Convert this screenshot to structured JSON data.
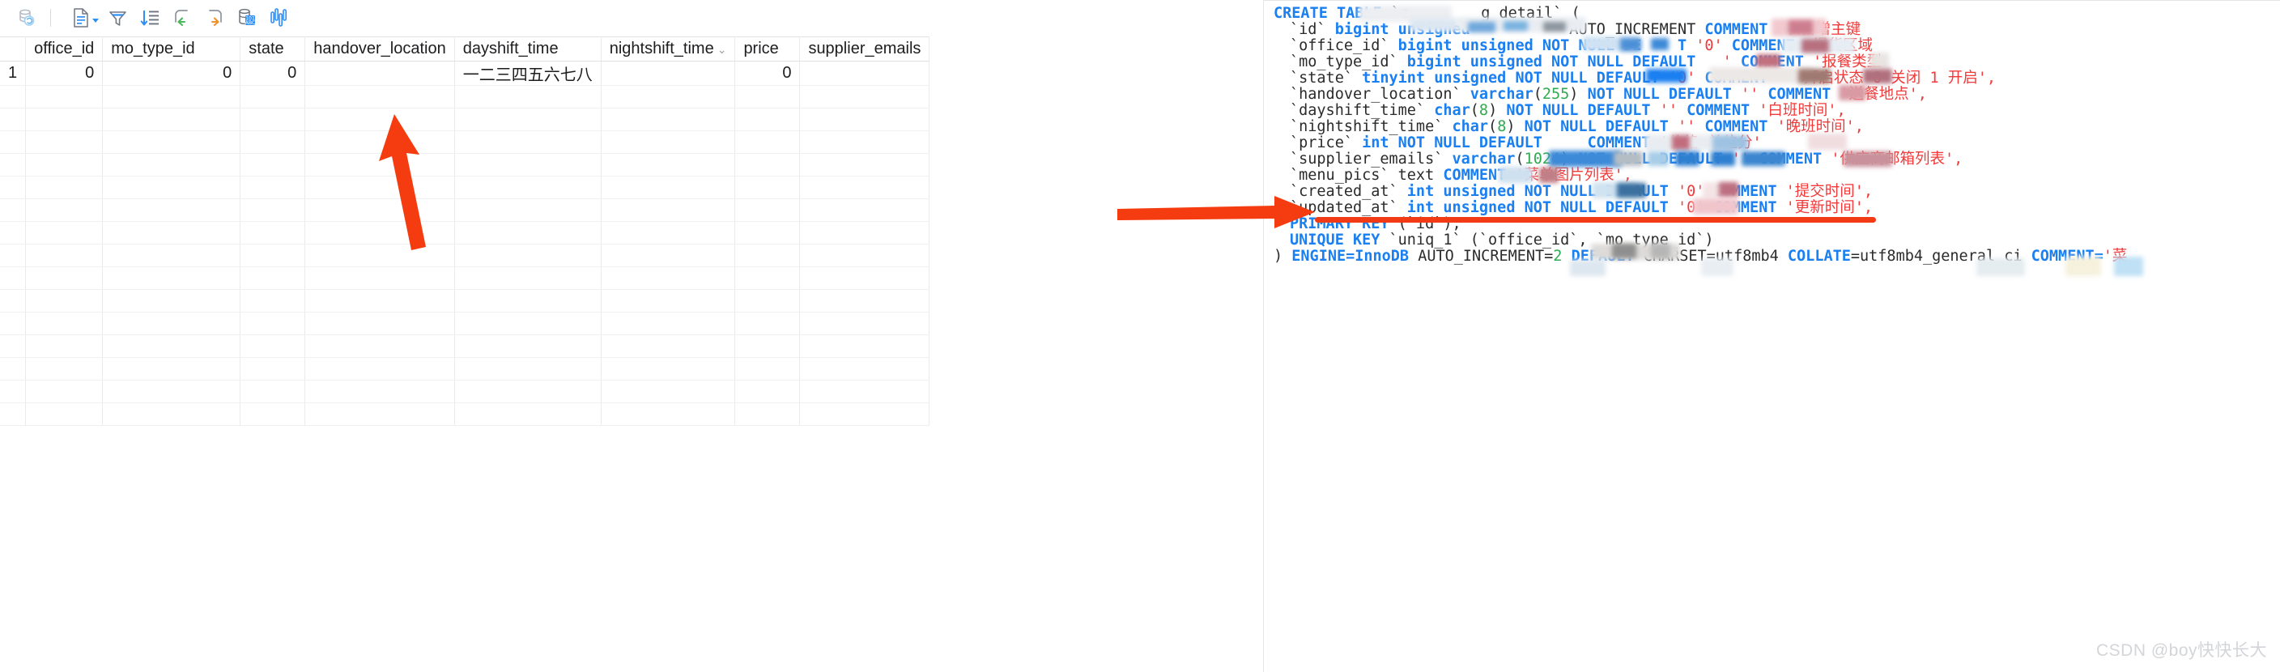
{
  "toolbar": {
    "buttons": [
      {
        "name": "refresh-database-icon",
        "title": "Refresh"
      },
      {
        "name": "separator",
        "title": ""
      },
      {
        "name": "document-dropdown-icon",
        "title": "Generate SQL"
      },
      {
        "name": "filter-icon",
        "title": "Filter"
      },
      {
        "name": "sort-icon",
        "title": "Sort"
      },
      {
        "name": "undo-icon",
        "title": "Undo"
      },
      {
        "name": "redo-icon",
        "title": "Redo"
      },
      {
        "name": "database-text-icon",
        "title": "View as text"
      },
      {
        "name": "chart-bars-icon",
        "title": "Chart"
      }
    ]
  },
  "grid": {
    "row_header": "",
    "columns": [
      {
        "label": "office_id",
        "caret": false,
        "align": "right",
        "width": 88
      },
      {
        "label": "mo_type_id",
        "caret": false,
        "align": "right",
        "width": 170
      },
      {
        "label": "state",
        "caret": false,
        "align": "right",
        "width": 80
      },
      {
        "label": "handover_location",
        "caret": false,
        "align": "left",
        "width": 140
      },
      {
        "label": "dayshift_time",
        "caret": false,
        "align": "left",
        "width": 170
      },
      {
        "label": "nightshift_time",
        "caret": true,
        "align": "left",
        "width": 115
      },
      {
        "label": "price",
        "caret": false,
        "align": "right",
        "width": 80
      },
      {
        "label": "supplier_emails",
        "caret": false,
        "align": "left",
        "width": 110
      }
    ],
    "rows": [
      {
        "num": "1",
        "cells": [
          "0",
          "0",
          "0",
          "",
          "一二三四五六七八",
          "",
          "0",
          ""
        ]
      }
    ],
    "empty_row_count": 15
  },
  "sql": {
    "lines": [
      {
        "indent": 0,
        "tokens": [
          {
            "t": "CREATE TABLE ",
            "c": "kw"
          },
          {
            "t": "`c",
            "c": "tick"
          },
          {
            "t": "        ",
            "c": "tick"
          },
          {
            "t": "g_detail` (",
            "c": "tick"
          }
        ]
      },
      {
        "indent": 1,
        "tokens": [
          {
            "t": "`id` ",
            "c": "tick"
          },
          {
            "t": "bigint unsigned",
            "c": "kw"
          },
          {
            "t": " ",
            "c": "plain"
          },
          {
            "t": "        ",
            "c": "plain"
          },
          {
            "t": "  AUTO_INCREMENT ",
            "c": "plain"
          },
          {
            "t": "COMMENT ",
            "c": "kw"
          },
          {
            "t": "'表自增主键",
            "c": "str"
          }
        ]
      },
      {
        "indent": 1,
        "tokens": [
          {
            "t": "`office_id` ",
            "c": "tick"
          },
          {
            "t": "bigint unsigned NOT NULL DE",
            "c": "kw"
          },
          {
            "t": "  ",
            "c": "kw"
          },
          {
            "t": "  T ",
            "c": "kw"
          },
          {
            "t": "'0' ",
            "c": "str"
          },
          {
            "t": "COMMENT ",
            "c": "kw"
          },
          {
            "t": "'提货区域",
            "c": "str"
          }
        ]
      },
      {
        "indent": 1,
        "tokens": [
          {
            "t": "`mo_type_id` ",
            "c": "tick"
          },
          {
            "t": "bigint unsigned NOT NULL DEFAULT ",
            "c": "kw"
          },
          {
            "t": "  ' ",
            "c": "str"
          },
          {
            "t": "COMMENT ",
            "c": "kw"
          },
          {
            "t": "'报餐类型",
            "c": "str"
          }
        ]
      },
      {
        "indent": 1,
        "tokens": [
          {
            "t": "`state` ",
            "c": "tick"
          },
          {
            "t": "tinyint unsigned NOT NULL DEFAULT ",
            "c": "kw"
          },
          {
            "t": "'0' ",
            "c": "str"
          },
          {
            "t": "COMMENT ",
            "c": "kw"
          },
          {
            "t": "  '开启状态 0 关闭 1 开启',",
            "c": "str"
          }
        ]
      },
      {
        "indent": 1,
        "tokens": [
          {
            "t": "`handover_location` ",
            "c": "tick"
          },
          {
            "t": "varchar",
            "c": "kw"
          },
          {
            "t": "(",
            "c": "plain"
          },
          {
            "t": "255",
            "c": "num2"
          },
          {
            "t": ") ",
            "c": "plain"
          },
          {
            "t": "NOT NULL DEFAULT ",
            "c": "kw"
          },
          {
            "t": "'' ",
            "c": "str"
          },
          {
            "t": "COMMENT ",
            "c": "kw"
          },
          {
            "t": "'送餐地点',",
            "c": "str"
          }
        ]
      },
      {
        "indent": 1,
        "tokens": [
          {
            "t": "`dayshift_time` ",
            "c": "tick"
          },
          {
            "t": "char",
            "c": "kw"
          },
          {
            "t": "(",
            "c": "plain"
          },
          {
            "t": "8",
            "c": "num2"
          },
          {
            "t": ") ",
            "c": "plain"
          },
          {
            "t": "NOT NULL DEFAULT ",
            "c": "kw"
          },
          {
            "t": "'' ",
            "c": "str"
          },
          {
            "t": "COMMENT ",
            "c": "kw"
          },
          {
            "t": "'白班时间',",
            "c": "str"
          }
        ]
      },
      {
        "indent": 1,
        "tokens": [
          {
            "t": "`nightshift_time` ",
            "c": "tick"
          },
          {
            "t": "char",
            "c": "kw"
          },
          {
            "t": "(",
            "c": "plain"
          },
          {
            "t": "8",
            "c": "num2"
          },
          {
            "t": ") ",
            "c": "plain"
          },
          {
            "t": "NOT NULL DEFAULT ",
            "c": "kw"
          },
          {
            "t": "'' ",
            "c": "str"
          },
          {
            "t": "COMMENT ",
            "c": "kw"
          },
          {
            "t": "'晚班时间',",
            "c": "str"
          }
        ]
      },
      {
        "indent": 1,
        "tokens": [
          {
            "t": "`price` ",
            "c": "tick"
          },
          {
            "t": "int NOT NULL DEFAULT ",
            "c": "kw"
          },
          {
            "t": "    ",
            "c": "kw"
          },
          {
            "t": "COMMENT ",
            "c": "kw"
          },
          {
            "t": "'价格 单位分'",
            "c": "str"
          }
        ]
      },
      {
        "indent": 1,
        "tokens": [
          {
            "t": "`supplier_emails` ",
            "c": "tick"
          },
          {
            "t": "varchar",
            "c": "kw"
          },
          {
            "t": "(",
            "c": "plain"
          },
          {
            "t": "1024",
            "c": "num2"
          },
          {
            "t": ") ",
            "c": "plain"
          },
          {
            "t": "NOT NULL DEFAULT ",
            "c": "kw"
          },
          {
            "t": "'' ",
            "c": "str"
          },
          {
            "t": "COMMENT ",
            "c": "kw"
          },
          {
            "t": "'供应商邮箱列表',",
            "c": "str"
          }
        ]
      },
      {
        "indent": 1,
        "tokens": [
          {
            "t": "`menu_pics` ",
            "c": "tick"
          },
          {
            "t": "text ",
            "c": "plain"
          },
          {
            "t": "COMMENT ",
            "c": "kw"
          },
          {
            "t": "'菜单图片列表',",
            "c": "str"
          }
        ]
      },
      {
        "indent": 1,
        "tokens": [
          {
            "t": "`created_at` ",
            "c": "tick"
          },
          {
            "t": "int unsigned NOT NULL DEFAULT ",
            "c": "kw"
          },
          {
            "t": "'0' ",
            "c": "str"
          },
          {
            "t": "COMMENT ",
            "c": "kw"
          },
          {
            "t": "'提交时间',",
            "c": "str"
          }
        ]
      },
      {
        "indent": 1,
        "tokens": [
          {
            "t": "`updated_at` ",
            "c": "tick"
          },
          {
            "t": "int unsigned NOT NULL DEFAULT ",
            "c": "kw"
          },
          {
            "t": "'0' ",
            "c": "str"
          },
          {
            "t": "COMMENT ",
            "c": "kw"
          },
          {
            "t": "'更新时间',",
            "c": "str"
          }
        ]
      },
      {
        "indent": 1,
        "tokens": [
          {
            "t": "PRIMARY KEY ",
            "c": "kw"
          },
          {
            "t": "(`id`),",
            "c": "tick"
          }
        ]
      },
      {
        "indent": 1,
        "tokens": [
          {
            "t": "UNIQUE KEY ",
            "c": "kw"
          },
          {
            "t": "`uniq_1` (`office_id`, `mo_type_id`)",
            "c": "tick"
          }
        ]
      },
      {
        "indent": 0,
        "tokens": [
          {
            "t": ") ",
            "c": "plain"
          },
          {
            "t": "ENGINE=InnoDB ",
            "c": "kw"
          },
          {
            "t": "AUTO_INCREMENT=",
            "c": "plain"
          },
          {
            "t": "2",
            "c": "num2"
          },
          {
            "t": " ",
            "c": "plain"
          },
          {
            "t": "DEFAULT ",
            "c": "kw"
          },
          {
            "t": "CHARSET=utf8mb4 ",
            "c": "plain"
          },
          {
            "t": "COLLATE",
            "c": "kw"
          },
          {
            "t": "=utf8mb4_general_ci ",
            "c": "plain"
          },
          {
            "t": "COMMENT=",
            "c": "kw"
          },
          {
            "t": "'菜",
            "c": "str"
          }
        ]
      }
    ],
    "highlight_line_index": 6,
    "underline_color": "#f23b14",
    "arrow_color": "#f53c10"
  },
  "watermark": {
    "text": "CSDN @boy快快长大"
  },
  "colors": {
    "accent_blue": "#1a7ff0",
    "string_red": "#f23a3a",
    "number_green": "#2faa4e",
    "arrow_red": "#f53c10",
    "grid_line": "#e9eaec",
    "alt_row": "#f5f9fd"
  }
}
